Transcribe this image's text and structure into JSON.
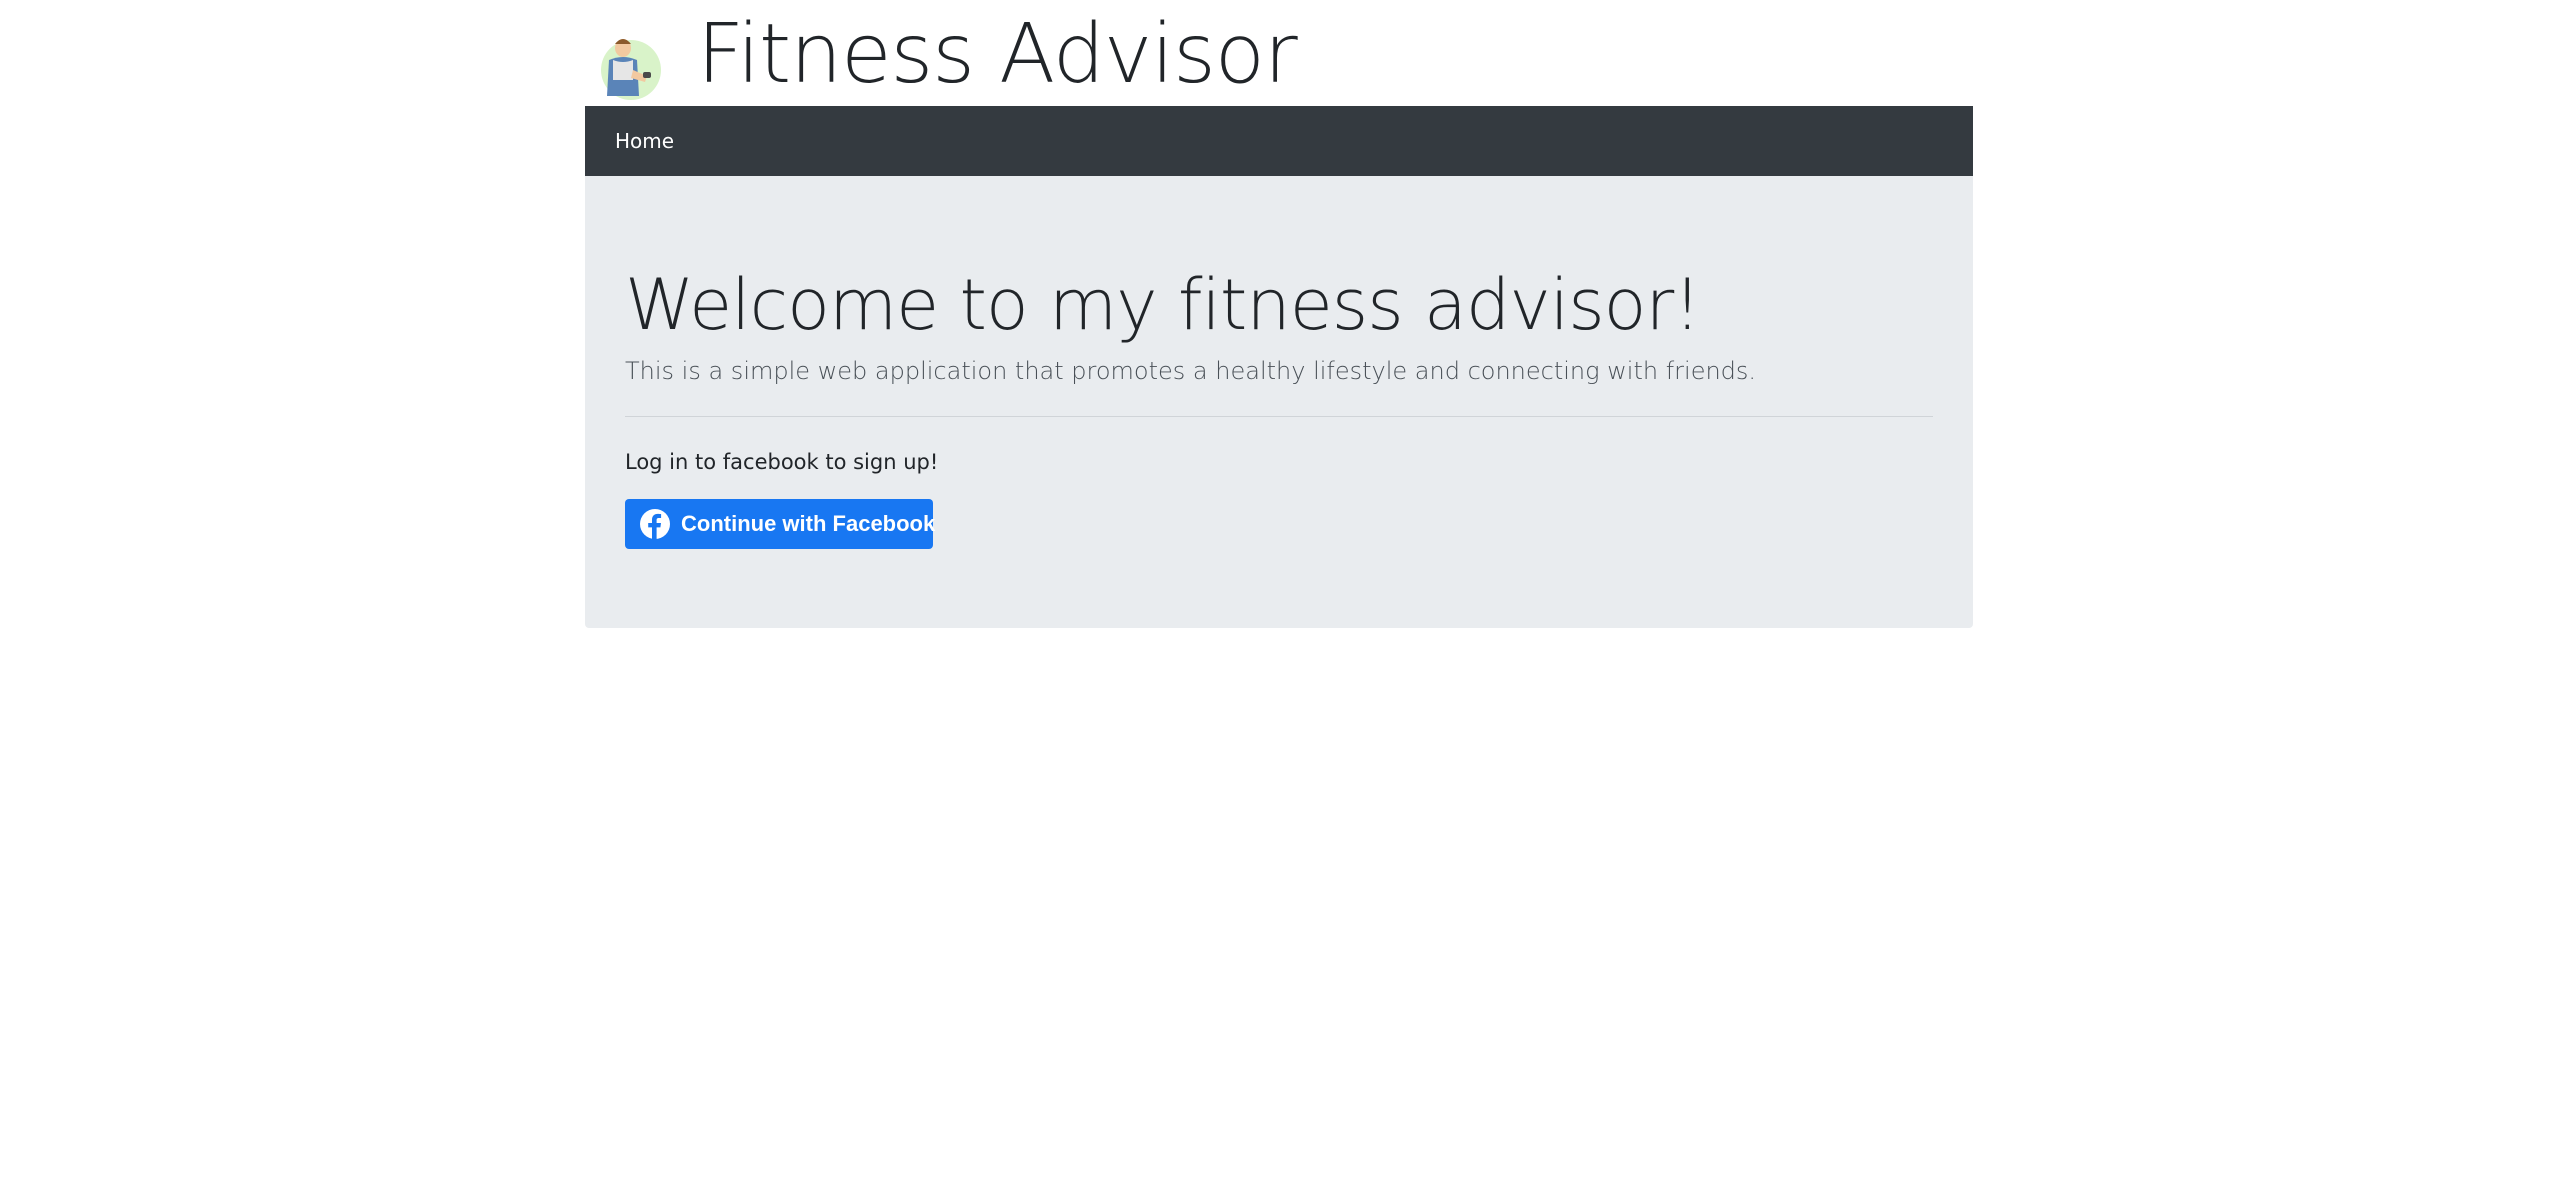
{
  "header": {
    "title": "Fitness Advisor",
    "logo_icon": "fitness-man-icon"
  },
  "nav": {
    "items": [
      {
        "label": "Home"
      }
    ],
    "background": "#343a40"
  },
  "jumbotron": {
    "heading": "Welcome to my fitness advisor!",
    "lead": "This is a simple web application that promotes a healthy lifestyle and connecting with friends.",
    "signup_text": "Log in to facebook to sign up!",
    "facebook_button": {
      "label": "Continue with Facebook",
      "icon": "facebook-icon",
      "color": "#1877f2"
    },
    "background": "#e9ecef"
  }
}
